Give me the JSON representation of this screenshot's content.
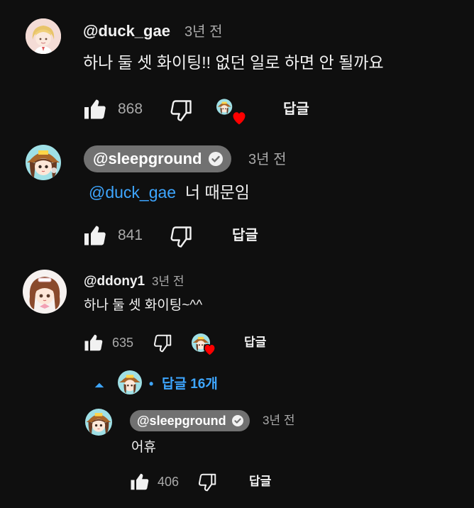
{
  "comments": [
    {
      "author": "@duck_gae",
      "time": "3년 전",
      "text": "하나 둘 셋 화이팅!! 없던 일로 하면 안 될까요",
      "likes": "868",
      "reply_label": "답글",
      "hearted": true
    },
    {
      "author": "@sleepground",
      "time": "3년 전",
      "mention": "@duck_gae",
      "text": "너 때문임",
      "likes": "841",
      "reply_label": "답글",
      "verified_creator": true
    },
    {
      "author": "@ddony1",
      "time": "3년 전",
      "text": "하나 둘 셋 화이팅~^^",
      "likes": "635",
      "reply_label": "답글",
      "hearted": true
    }
  ],
  "replies_toggle": {
    "dot": "•",
    "label": "답글 16개",
    "state": "expanded"
  },
  "nested_reply": {
    "author": "@sleepground",
    "time": "3년 전",
    "text": "어휴",
    "likes": "406",
    "reply_label": "답글"
  },
  "icons": {
    "like": "thumb-up-icon",
    "dislike": "thumb-down-icon",
    "heart": "heart-icon",
    "verified": "check-circle-icon",
    "collapse": "caret-up-icon"
  },
  "colors": {
    "background": "#0f0f0f",
    "text": "#f1f1f1",
    "muted": "#aaaaaa",
    "link": "#3ea6ff",
    "chip": "#717171",
    "heart": "#ff0000"
  }
}
